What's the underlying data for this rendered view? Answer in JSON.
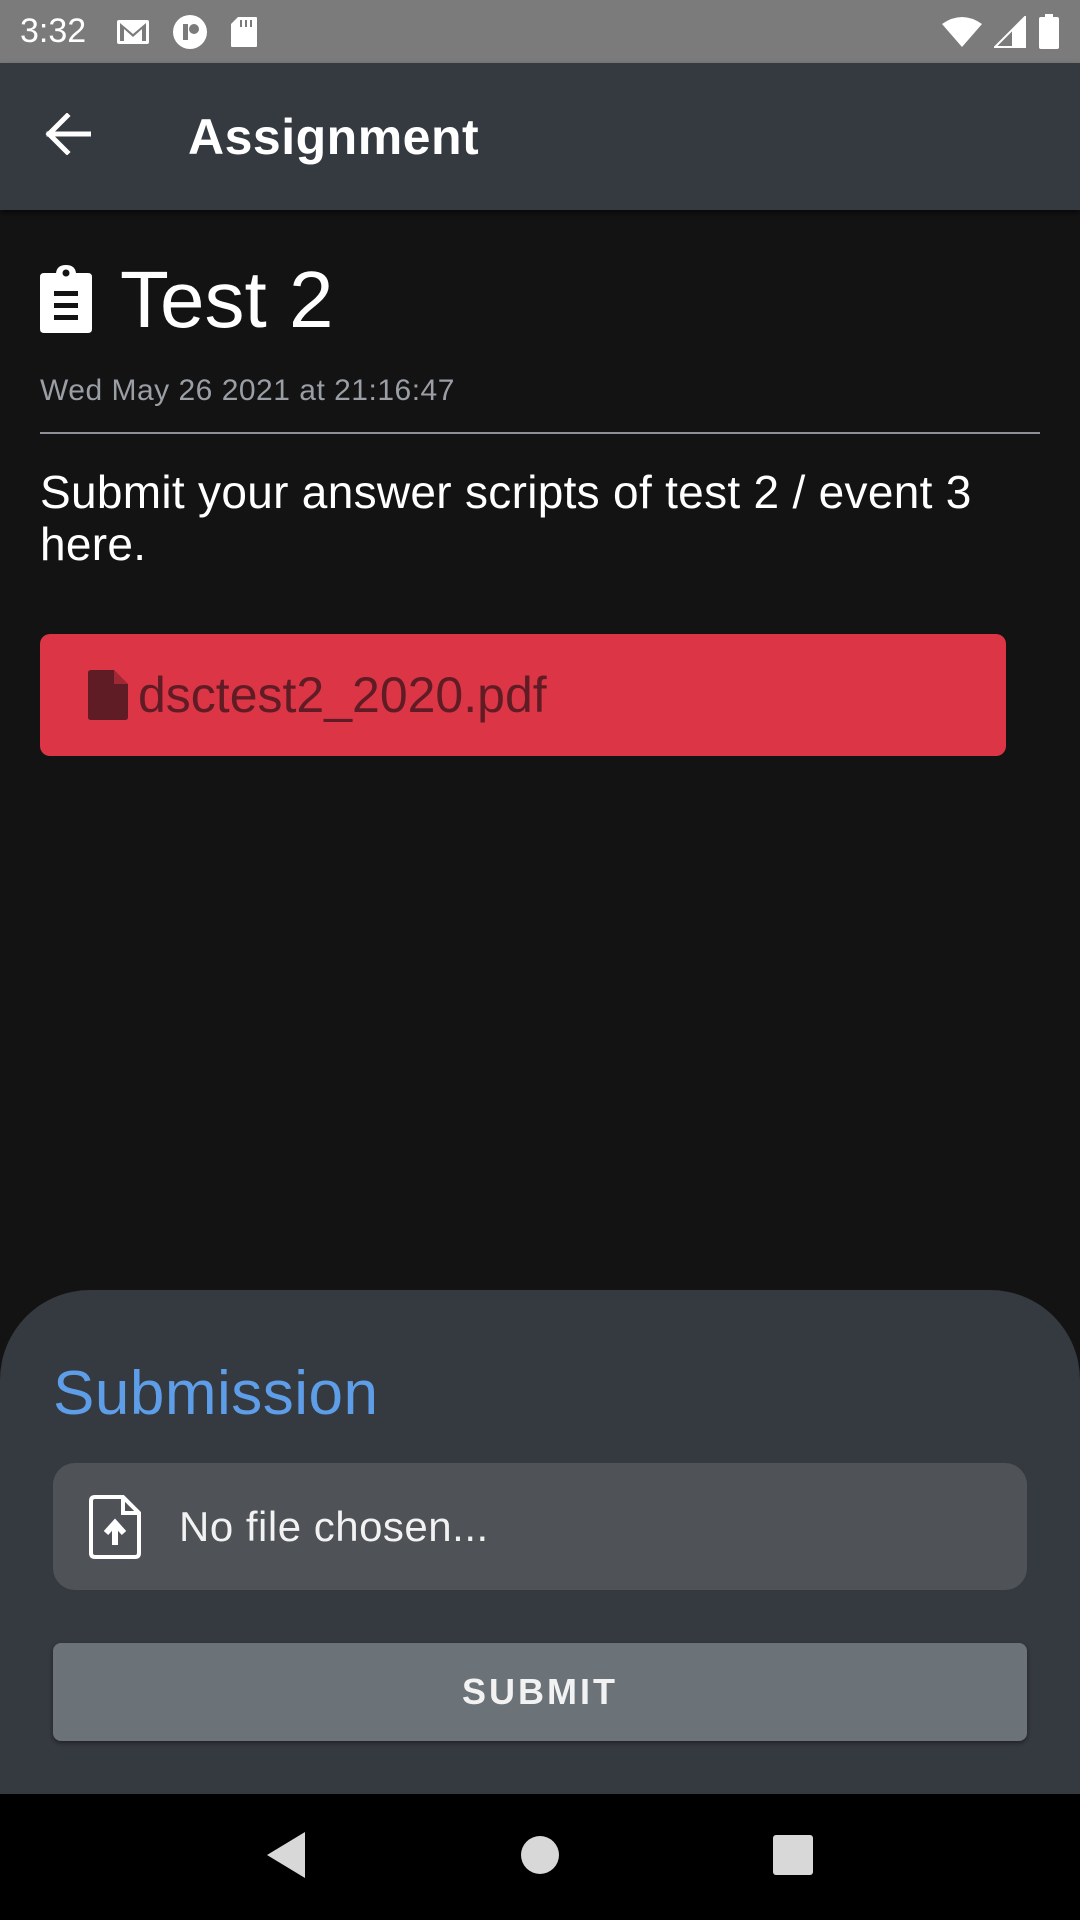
{
  "status_bar": {
    "time": "3:32",
    "left_icons": [
      "gmail-icon",
      "app-notification-icon",
      "sd-card-icon"
    ],
    "right_icons": [
      "wifi-icon",
      "cell-signal-icon",
      "battery-icon"
    ]
  },
  "app_bar": {
    "back_icon": "arrow-back-icon",
    "title": "Assignment"
  },
  "assignment": {
    "icon": "clipboard-icon",
    "title": "Test 2",
    "timestamp": "Wed May 26 2021 at 21:16:47",
    "description": "Submit your answer scripts of test 2 / event 3 here.",
    "attachment": {
      "icon": "file-icon",
      "name": "dsctest2_2020.pdf",
      "color": "#dc3545"
    }
  },
  "submission": {
    "title": "Submission",
    "title_color": "#5e9ee9",
    "file_picker": {
      "icon": "file-upload-icon",
      "placeholder": "No file chosen..."
    },
    "submit_label": "SUBMIT"
  },
  "nav_bar": {
    "items": [
      "back-triangle-icon",
      "home-circle-icon",
      "recents-square-icon"
    ]
  }
}
